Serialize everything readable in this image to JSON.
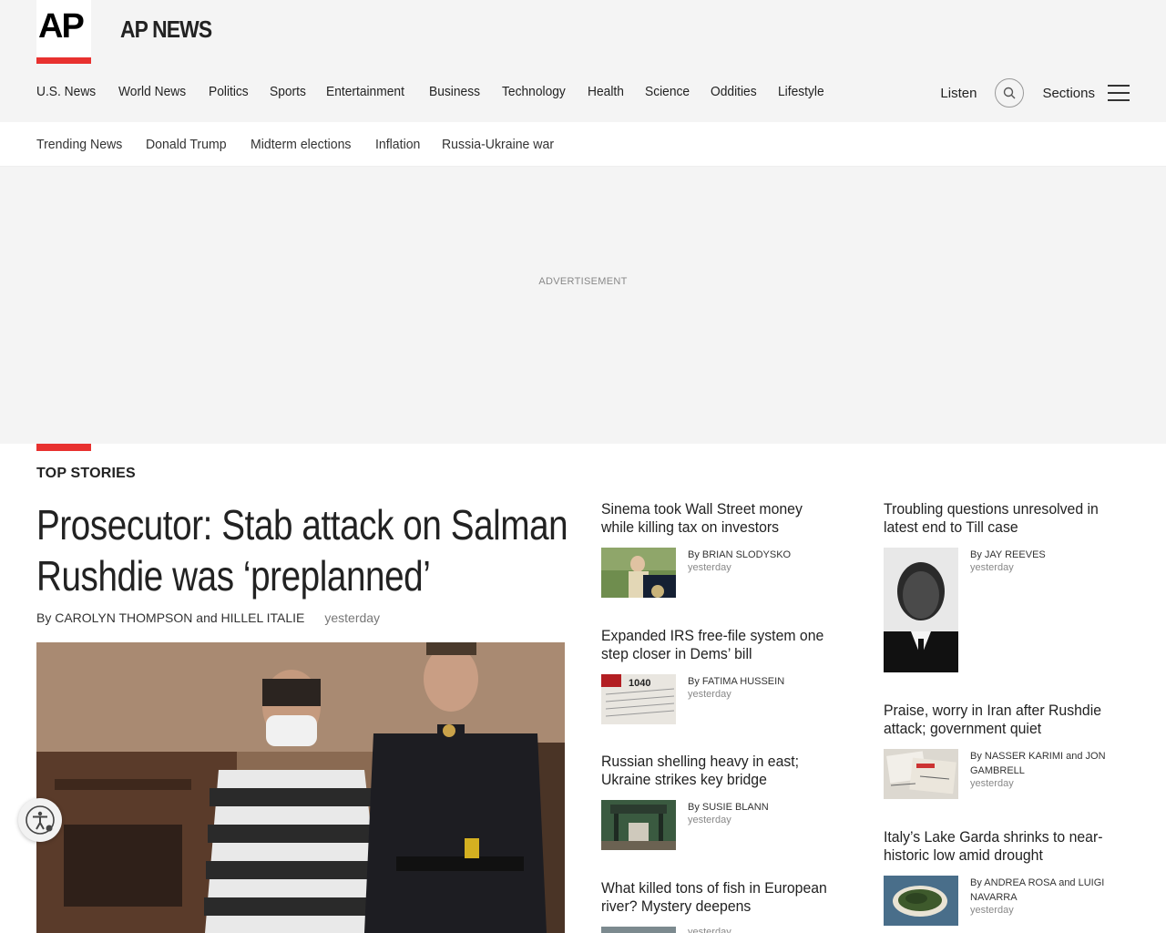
{
  "brand": {
    "logo": "AP",
    "name": "AP NEWS"
  },
  "nav": {
    "items": [
      "U.S. News",
      "World News",
      "Politics",
      "Sports",
      "Entertainment",
      "Business",
      "Technology",
      "Health",
      "Science",
      "Oddities",
      "Lifestyle"
    ],
    "listen": "Listen",
    "sections": "Sections"
  },
  "trending": [
    "Trending News",
    "Donald Trump",
    "Midterm elections",
    "Inflation",
    "Russia-Ukraine war"
  ],
  "ad": {
    "label": "ADVERTISEMENT"
  },
  "top_stories": {
    "label": "TOP STORIES",
    "lead": {
      "title_line1": "Prosecutor: Stab attack on Salman",
      "title_line2": "Rushdie was ‘preplanned’",
      "byline": "By CAROLYN THOMPSON and HILLEL ITALIE",
      "time": "yesterday"
    },
    "middle": [
      {
        "title": "Sinema took Wall Street money while killing tax on investors",
        "author": "By BRIAN SLODYSKO",
        "time": "yesterday"
      },
      {
        "title": "Expanded IRS free-file system one step closer in Dems’ bill",
        "author": "By FATIMA HUSSEIN",
        "time": "yesterday"
      },
      {
        "title": "Russian shelling heavy in east; Ukraine strikes key bridge",
        "author": "By SUSIE BLANN",
        "time": "yesterday"
      },
      {
        "title": "What killed tons of fish in European river? Mystery deepens",
        "author": "",
        "time": "yesterday"
      }
    ],
    "right": [
      {
        "title": "Troubling questions unresolved in latest end to Till case",
        "author": "By JAY REEVES",
        "time": "yesterday"
      },
      {
        "title": "Praise, worry in Iran after Rushdie attack; government quiet",
        "author": "By NASSER KARIMI and JON GAMBRELL",
        "time": "yesterday"
      },
      {
        "title": "Italy’s Lake Garda shrinks to near-historic low amid drought",
        "author": "By ANDREA ROSA and LUIGI NAVARRA",
        "time": "yesterday"
      }
    ]
  },
  "colors": {
    "accent": "#e8312f",
    "header_bg": "#f4f4f4"
  }
}
